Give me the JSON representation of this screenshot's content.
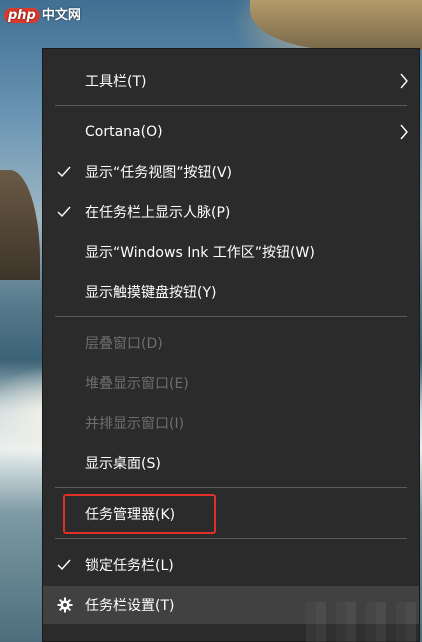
{
  "watermark": {
    "badge": "php",
    "text": "中文网"
  },
  "menu": {
    "items": [
      {
        "label": "工具栏(T)",
        "submenu": true
      },
      {
        "label": "Cortana(O)",
        "submenu": true
      },
      {
        "label": "显示“任务视图”按钮(V)",
        "checked": true
      },
      {
        "label": "在任务栏上显示人脉(P)",
        "checked": true
      },
      {
        "label": "显示“Windows Ink 工作区”按钮(W)"
      },
      {
        "label": "显示触摸键盘按钮(Y)"
      },
      {
        "label": "层叠窗口(D)",
        "disabled": true
      },
      {
        "label": "堆叠显示窗口(E)",
        "disabled": true
      },
      {
        "label": "并排显示窗口(I)",
        "disabled": true
      },
      {
        "label": "显示桌面(S)"
      },
      {
        "label": "任务管理器(K)",
        "highlighted": true
      },
      {
        "label": "锁定任务栏(L)",
        "checked": true
      },
      {
        "label": "任务栏设置(T)",
        "icon": "gear-icon"
      }
    ]
  },
  "colors": {
    "menu_bg": "#2b2b2b",
    "text": "#ffffff",
    "disabled_text": "#6e6e6e",
    "separator": "#5a5a5a",
    "highlight_border": "#e0302a"
  }
}
